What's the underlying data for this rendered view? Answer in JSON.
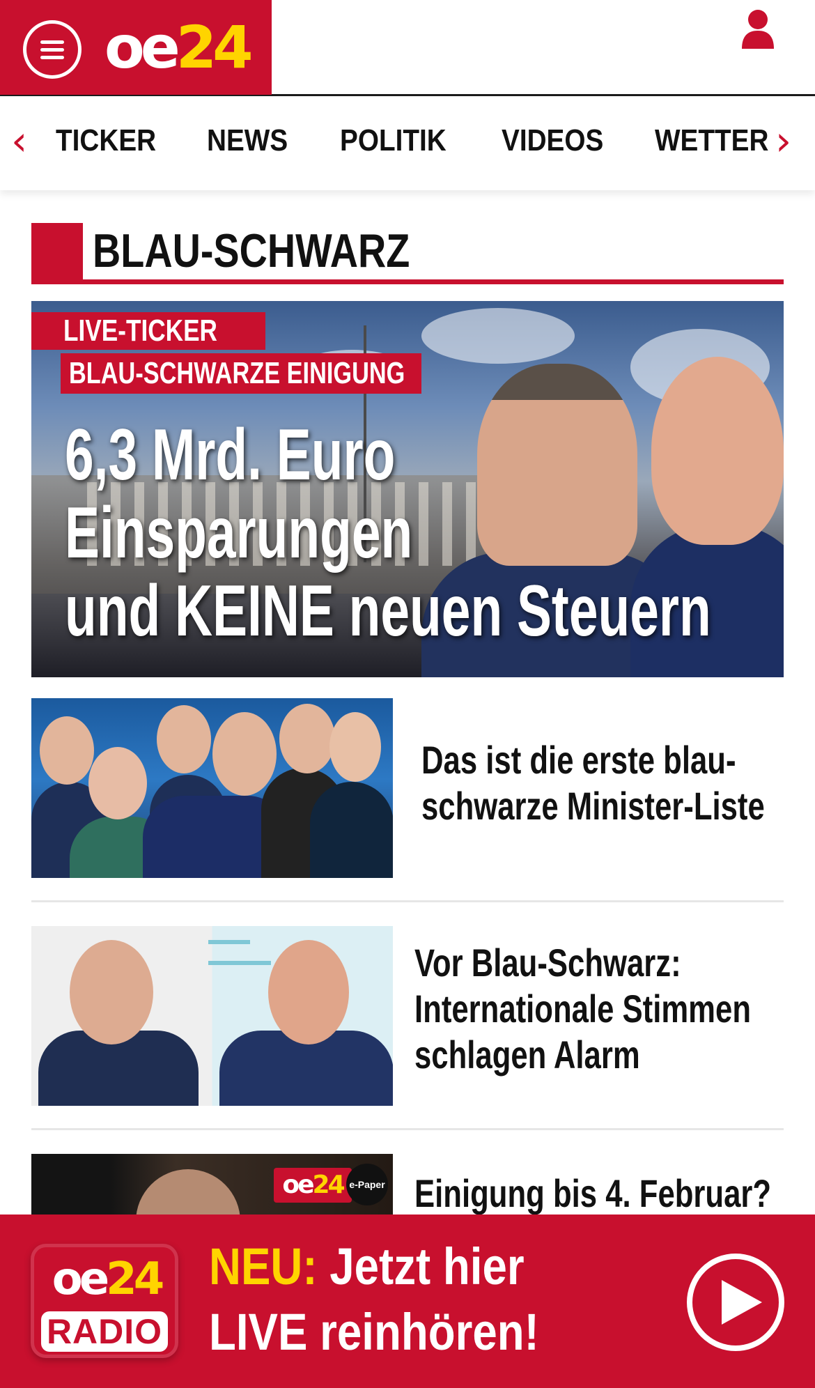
{
  "header": {
    "logo_left": "oe",
    "logo_right": "24"
  },
  "nav": {
    "items": [
      {
        "label": "TICKER"
      },
      {
        "label": "NEWS"
      },
      {
        "label": "POLITIK"
      },
      {
        "label": "VIDEOS"
      },
      {
        "label": "WETTER"
      }
    ]
  },
  "section": {
    "title": "BLAU-SCHWARZ"
  },
  "hero": {
    "badge_live": "LIVE-TICKER",
    "badge_sub": "BLAU-SCHWARZE EINIGUNG",
    "headline": [
      "6,3 Mrd. Euro",
      "Einsparungen",
      "und KEINE neuen Steuern"
    ]
  },
  "articles": [
    {
      "title_lines": [
        "Das ist die erste blau-",
        "schwarze Minister-Liste"
      ]
    },
    {
      "title_lines": [
        "Vor Blau-Schwarz:",
        "Internationale Stimmen",
        "schlagen Alarm"
      ]
    },
    {
      "title_lines": [
        "Einigung bis 4. Februar?"
      ],
      "thumb_badge_left": "oe",
      "thumb_badge_right": "24",
      "thumb_badge_circle": "e-Paper"
    }
  ],
  "radio": {
    "logo_left": "oe",
    "logo_right": "24",
    "logo_label": "RADIO",
    "neu": "NEU:",
    "line1_rest": " Jetzt hier",
    "line2": "LIVE reinhören!"
  },
  "colors": {
    "brand_red": "#c8102e",
    "brand_yellow": "#ffd400"
  },
  "icons": {
    "menu": "hamburger-menu-icon",
    "user": "user-icon",
    "nav_prev": "chevron-left-icon",
    "nav_next": "chevron-right-icon",
    "play": "play-icon"
  }
}
